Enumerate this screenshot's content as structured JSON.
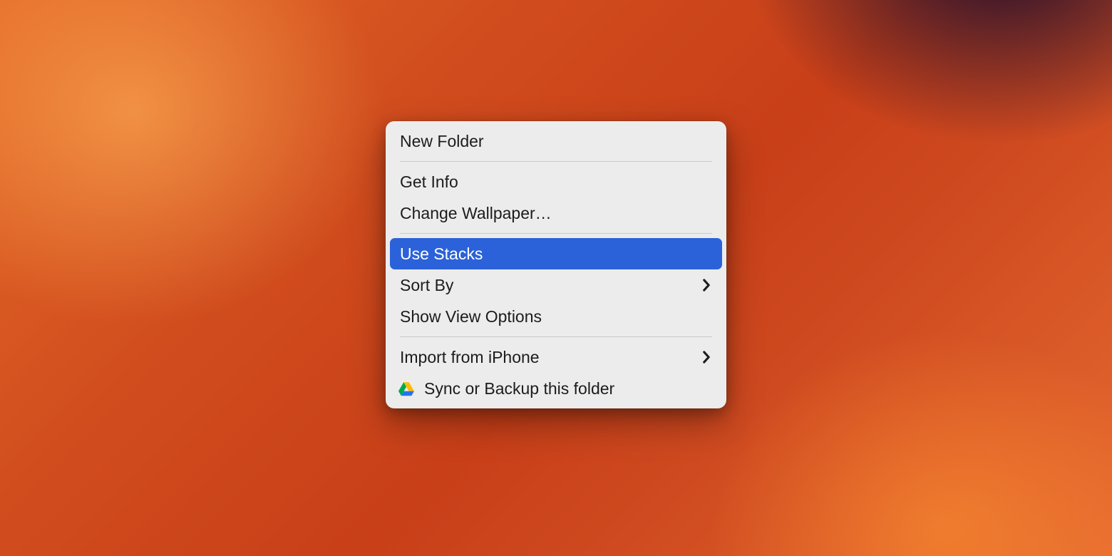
{
  "context_menu": {
    "items": {
      "new_folder": {
        "label": "New Folder"
      },
      "get_info": {
        "label": "Get Info"
      },
      "change_wallpaper": {
        "label": "Change Wallpaper…"
      },
      "use_stacks": {
        "label": "Use Stacks",
        "highlighted": true
      },
      "sort_by": {
        "label": "Sort By",
        "has_submenu": true
      },
      "show_view_options": {
        "label": "Show View Options"
      },
      "import_from_iphone": {
        "label": "Import from iPhone",
        "has_submenu": true
      },
      "sync_or_backup": {
        "label": "Sync or Backup this folder",
        "icon": "google-drive"
      }
    }
  }
}
